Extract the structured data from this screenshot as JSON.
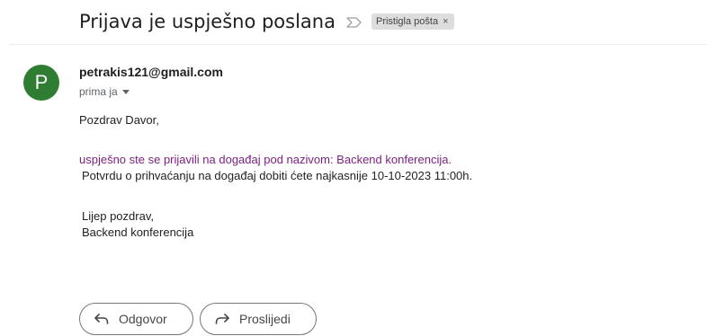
{
  "email": {
    "subject": "Prijava je uspješno poslana",
    "label": "Pristigla pošta",
    "label_remove": "×",
    "sender": {
      "initial": "P",
      "address": "petrakis121@gmail.com",
      "avatar_color": "#2e7d32"
    },
    "recipient_text": "prima ja",
    "body": {
      "greeting": "Pozdrav Davor,",
      "line_purple": "uspješno ste se prijavili na događaj pod nazivom: Backend konferencija.",
      "line_confirm": "Potvrdu o prihvaćanju na događaj dobiti ćete najkasnije 10-10-2023 11:00h.",
      "signoff": "Lijep pozdrav,",
      "signature": "Backend konferencija"
    }
  },
  "actions": {
    "reply_label": "Odgovor",
    "forward_label": "Proslijedi"
  },
  "icons": {
    "important": "important-marker-icon",
    "reply": "reply-arrow-icon",
    "forward": "forward-arrow-icon",
    "dropdown": "chevron-down-icon"
  },
  "colors": {
    "link_purple": "#7a1f7e",
    "avatar_green": "#2e7d32"
  }
}
